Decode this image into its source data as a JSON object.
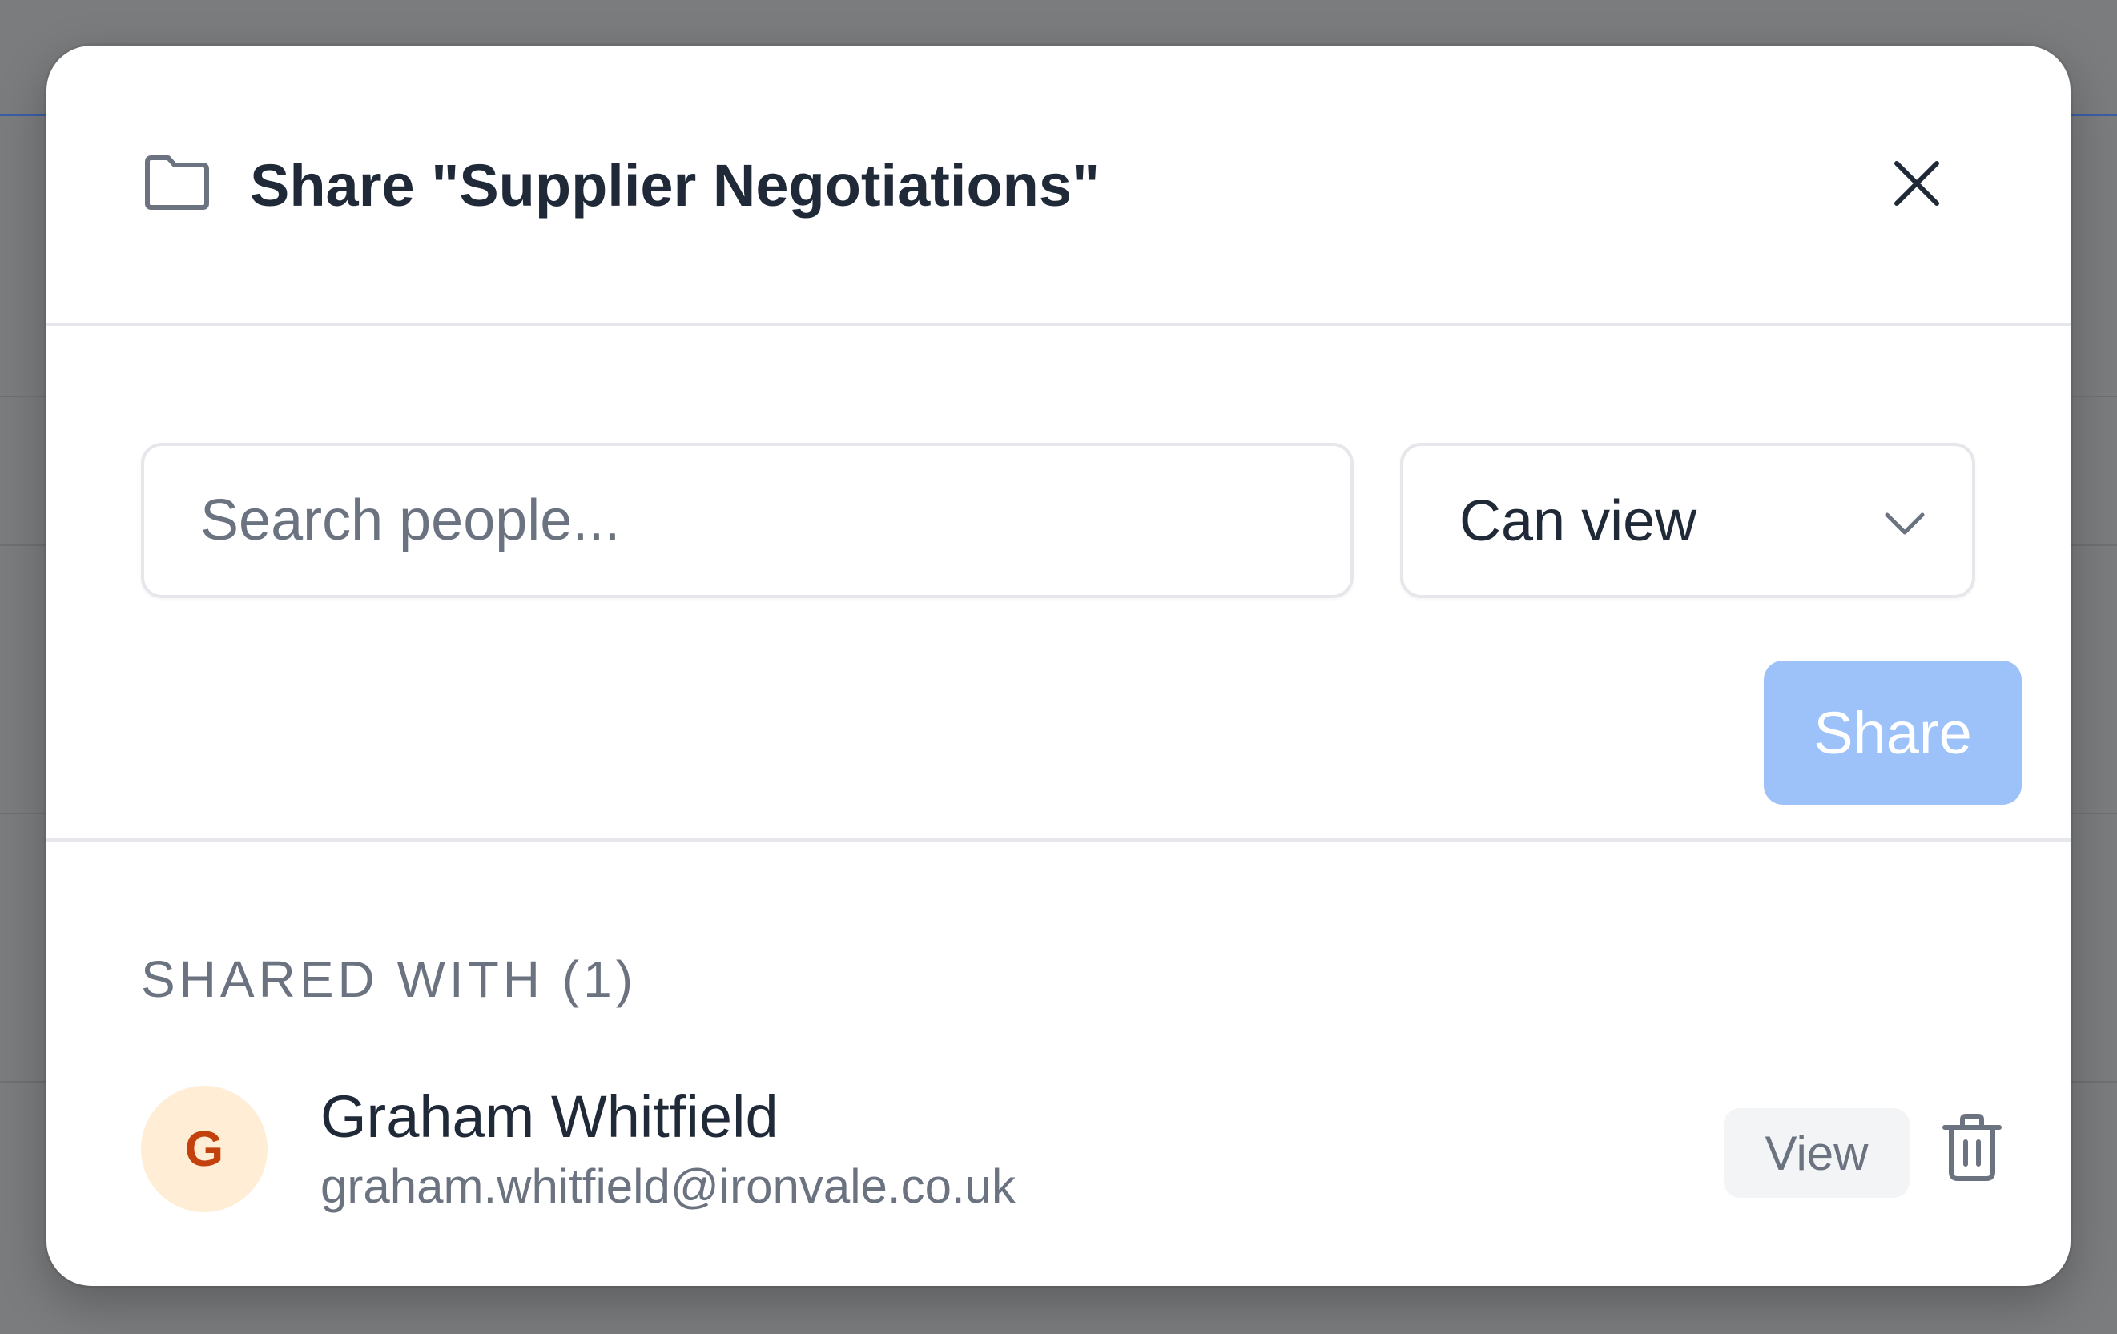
{
  "dialog": {
    "title": "Share \"Supplier Negotiations\"",
    "close_label": "Close"
  },
  "share_form": {
    "search_placeholder": "Search people...",
    "search_value": "",
    "permission_selected": "Can view",
    "share_button_label": "Share",
    "share_button_enabled": false
  },
  "shared_with": {
    "heading": "SHARED WITH (1)",
    "users": [
      {
        "avatar_initial": "G",
        "name": "Graham Whitfield",
        "email": "graham.whitfield@ironvale.co.uk",
        "role": "View"
      }
    ]
  },
  "icons": {
    "header": "folder-icon",
    "close": "close-icon",
    "select": "chevron-down-icon",
    "remove": "trash-icon"
  },
  "colors": {
    "overlay": "#7b7c7e",
    "primary_disabled": "#9dc2fa",
    "text_primary": "#1f2937",
    "text_muted": "#6b7280",
    "avatar_bg": "#ffedd5",
    "avatar_fg": "#c2410c",
    "badge_bg": "#f3f4f6",
    "divider": "#e5e7eb"
  }
}
